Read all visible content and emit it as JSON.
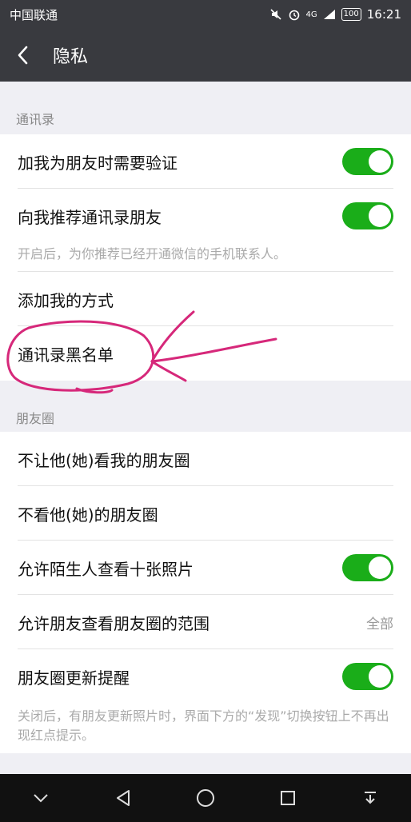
{
  "status_bar": {
    "carrier": "中国联通",
    "network": "4G",
    "battery": "100",
    "time": "16:21"
  },
  "header": {
    "title": "隐私",
    "back_icon": "chevron-left-icon"
  },
  "sections": {
    "contacts": {
      "heading": "通讯录",
      "verify_label": "加我为朋友时需要验证",
      "verify_on": true,
      "recommend_label": "向我推荐通讯录朋友",
      "recommend_on": true,
      "recommend_hint": "开启后，为你推荐已经开通微信的手机联系人。",
      "add_methods_label": "添加我的方式",
      "blacklist_label": "通讯录黑名单"
    },
    "moments": {
      "heading": "朋友圈",
      "hide_from_label": "不让他(她)看我的朋友圈",
      "not_view_label": "不看他(她)的朋友圈",
      "stranger_ten_label": "允许陌生人查看十张照片",
      "stranger_ten_on": true,
      "range_label": "允许朋友查看朋友圈的范围",
      "range_value": "全部",
      "update_remind_label": "朋友圈更新提醒",
      "update_remind_on": true,
      "update_hint": "关闭后，有朋友更新照片时，界面下方的“发现”切换按钮上不再出现红点提示。"
    }
  },
  "colors": {
    "toggle_on": "#1aad19",
    "header_bg": "#393a3f",
    "annotation": "#d6287a"
  }
}
